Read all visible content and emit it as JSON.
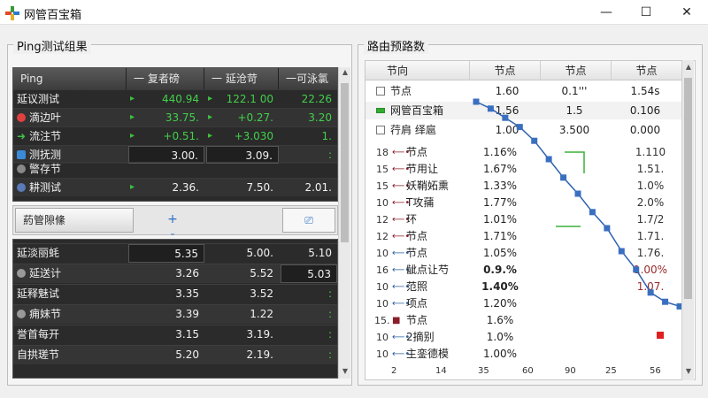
{
  "window": {
    "title": "网管百宝箱",
    "minimize": "—",
    "maximize": "☐",
    "close": "✕"
  },
  "ping_group": {
    "title": "Ping测试组果",
    "columns": [
      "Ping",
      "一 复者磅",
      "一 延沧苛",
      "一可泳氯"
    ],
    "rows": [
      {
        "label": "延议测试",
        "icon": "",
        "v1": "440.94",
        "v2": "122.1 00",
        "v3": "22.26",
        "color": "green"
      },
      {
        "label": "滴边叶",
        "icon": "red-dot",
        "v1": "33.75.",
        "v2": "+0.27.",
        "v3": "3.20",
        "color": "green"
      },
      {
        "label": "流注节",
        "icon": "green-arrow",
        "v1": "+0.51.",
        "v2": "+3.030",
        "v3": "1.",
        "color": "green"
      },
      {
        "label": "测抚测",
        "icon": "blue-plus",
        "v1": "3.00.",
        "v2": "3.09.",
        "v3": ":",
        "color": "white"
      },
      {
        "label": "警存节",
        "icon": "gray-plus",
        "v1": "",
        "v2": "",
        "v3": "",
        "color": "white"
      },
      {
        "label": "耕测试",
        "icon": "blue-gear",
        "v1": "2.36.",
        "v2": "7.50.",
        "v3": "2.01.",
        "color": "white"
      }
    ]
  },
  "toolbar": {
    "label": "葯管隙絛",
    "add": "+",
    "monitor": "⎚"
  },
  "ping_rows2": [
    {
      "label": "延淡丽蚝",
      "icon": "",
      "v1": "5.35",
      "v2": "5.00.",
      "v3": "5.10",
      "c3": "white"
    },
    {
      "label": "延送计",
      "icon": "clock",
      "v1": "3.26",
      "v2": "5.52",
      "v3": "5.03",
      "c3": "white"
    },
    {
      "label": "延释魅试",
      "icon": "",
      "v1": "3.35",
      "v2": "3.52",
      "v3": ":",
      "c3": "green"
    },
    {
      "label": "痈妹节",
      "icon": "clock",
      "v1": "3.39",
      "v2": "1.22",
      "v3": ":",
      "c3": "green"
    },
    {
      "label": "誉首每开",
      "icon": "",
      "v1": "3.15",
      "v2": "3.19.",
      "v3": ":",
      "c3": "green"
    },
    {
      "label": "自拱瑳节",
      "icon": "",
      "v1": "5.20",
      "v2": "2.19.",
      "v3": ":",
      "c3": "green"
    }
  ],
  "route_group": {
    "title": "路由预路数",
    "columns": [
      "节向",
      "节点",
      "节点",
      "节点"
    ],
    "legend": [
      {
        "name": "节点",
        "check": "empty",
        "a": "1.60",
        "b": "0.1'''",
        "c": "1.54s"
      },
      {
        "name": "网管百宝箱",
        "check": "green",
        "a": "1.56",
        "b": "1.5",
        "c": "0.106"
      },
      {
        "name": "荇肩 绎扈",
        "check": "empty",
        "a": "1.00",
        "b": "3.500",
        "c": "0.000"
      }
    ],
    "rows": [
      {
        "n": "18",
        "arrow": "red",
        "name": "节点",
        "pct": "1.16%",
        "right": "1.110",
        "bold": false,
        "red": false
      },
      {
        "n": "15",
        "arrow": "red",
        "name": "节用让",
        "pct": "1.67%",
        "right": "1.51.",
        "bold": false,
        "red": false
      },
      {
        "n": "15",
        "arrow": "red",
        "name": "妖鞘妬熏",
        "pct": "1.33%",
        "right": "1.0%",
        "bold": false,
        "red": false
      },
      {
        "n": "10",
        "arrow": "red",
        "name": "T攻蒱",
        "pct": "1.77%",
        "right": "2.0%",
        "bold": false,
        "red": false
      },
      {
        "n": "12",
        "arrow": "red",
        "name": "环",
        "pct": "1.01%",
        "right": "1.7/2",
        "bold": false,
        "red": false
      },
      {
        "n": "12",
        "arrow": "red",
        "name": "节点",
        "pct": "1.71%",
        "right": "1.71.",
        "bold": false,
        "red": false
      },
      {
        "n": "10",
        "arrow": "blue",
        "name": "节点",
        "pct": "1.05%",
        "right": "1.76.",
        "bold": false,
        "red": false
      },
      {
        "n": "16",
        "arrow": "blue",
        "name": "龇点让芍",
        "pct": "0.9.%",
        "right": "1.00%",
        "bold": true,
        "red": true
      },
      {
        "n": "10",
        "arrow": "blue",
        "name": "范照",
        "pct": "1.40%",
        "right": "1.07.",
        "bold": true,
        "red": true
      },
      {
        "n": "10",
        "arrow": "blue",
        "name": "项点",
        "pct": "1.20%",
        "right": "",
        "bold": false,
        "red": false
      },
      {
        "n": "15.",
        "arrow": "square",
        "name": "节点",
        "pct": "1.6%",
        "right": "",
        "bold": false,
        "red": false
      },
      {
        "n": "10",
        "arrow": "blue",
        "name": "2摘别",
        "pct": "1.0%",
        "right": "",
        "bold": false,
        "red": false
      },
      {
        "n": "10",
        "arrow": "blue",
        "name": "主銮德模",
        "pct": "1.00%",
        "right": "",
        "bold": false,
        "red": false
      }
    ],
    "x_ticks": [
      "2",
      "14",
      "35",
      "60",
      "90",
      "25",
      "56"
    ]
  },
  "chart_data": {
    "type": "line",
    "series": [
      {
        "values": [
          95,
          92,
          88,
          84,
          78,
          70,
          62,
          55,
          47,
          40,
          30,
          22,
          12,
          8,
          6
        ]
      }
    ],
    "marker_color": "#3a6fc0",
    "line_color": "#2d62b0",
    "extra_point_color": "#e02020"
  },
  "colors": {
    "grid_bg": "#2a2a2a",
    "accent_blue": "#2d62b0",
    "green": "#42d04a"
  }
}
